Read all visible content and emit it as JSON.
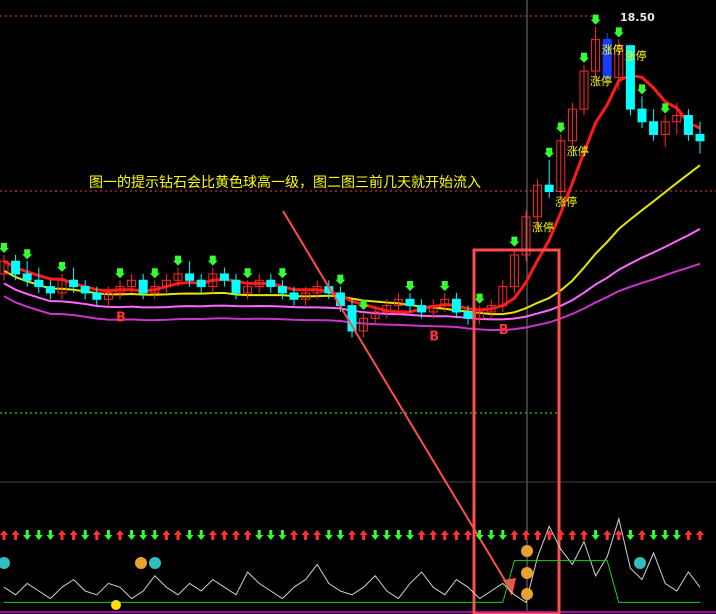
{
  "header": {
    "price_label": "18.50"
  },
  "annotation": {
    "text": "图一的提示钻石会比黄色球高一级，图二图三前几天就开始流入"
  },
  "labels": {
    "limit_up": "涨停",
    "buy": "B"
  },
  "colors": {
    "background": "#000000",
    "up_candle": "#ff2a2a",
    "down_candle": "#00ffff",
    "limit_candle": "#1a3cff",
    "ma_short": "#ff1a1a",
    "ma_mid": "#e6e600",
    "ma_long": "#ff66ff",
    "ma_slow": "#cc33cc",
    "highlight_box": "#ff4d4d",
    "arrow_down": "#33ff33",
    "arrow_up": "#ff3333",
    "limit_label": "#ffff00",
    "buy_label": "#ff3333",
    "grid_dashed": "#ff3333"
  },
  "chart_data": {
    "type": "candlestick",
    "candles": [
      [
        14.6,
        14.9,
        14.5,
        14.8
      ],
      [
        14.8,
        14.9,
        14.5,
        14.6
      ],
      [
        14.6,
        14.8,
        14.4,
        14.5
      ],
      [
        14.5,
        14.7,
        14.3,
        14.4
      ],
      [
        14.4,
        14.5,
        14.2,
        14.3
      ],
      [
        14.3,
        14.6,
        14.2,
        14.5
      ],
      [
        14.5,
        14.7,
        14.3,
        14.4
      ],
      [
        14.4,
        14.5,
        14.2,
        14.3
      ],
      [
        14.3,
        14.4,
        14.1,
        14.2
      ],
      [
        14.2,
        14.4,
        14.1,
        14.3
      ],
      [
        14.3,
        14.5,
        14.2,
        14.4
      ],
      [
        14.4,
        14.6,
        14.3,
        14.5
      ],
      [
        14.5,
        14.6,
        14.2,
        14.3
      ],
      [
        14.3,
        14.5,
        14.2,
        14.4
      ],
      [
        14.4,
        14.6,
        14.3,
        14.5
      ],
      [
        14.5,
        14.7,
        14.4,
        14.6
      ],
      [
        14.6,
        14.8,
        14.4,
        14.5
      ],
      [
        14.5,
        14.6,
        14.3,
        14.4
      ],
      [
        14.4,
        14.7,
        14.3,
        14.6
      ],
      [
        14.6,
        14.7,
        14.4,
        14.5
      ],
      [
        14.5,
        14.6,
        14.2,
        14.3
      ],
      [
        14.3,
        14.5,
        14.2,
        14.4
      ],
      [
        14.4,
        14.6,
        14.3,
        14.5
      ],
      [
        14.5,
        14.6,
        14.3,
        14.4
      ],
      [
        14.4,
        14.5,
        14.2,
        14.3
      ],
      [
        14.3,
        14.4,
        14.1,
        14.2
      ],
      [
        14.2,
        14.4,
        14.1,
        14.3
      ],
      [
        14.3,
        14.5,
        14.2,
        14.4
      ],
      [
        14.4,
        14.5,
        14.2,
        14.3
      ],
      [
        14.3,
        14.4,
        14.0,
        14.1
      ],
      [
        14.1,
        14.2,
        13.6,
        13.7
      ],
      [
        13.7,
        14.0,
        13.6,
        13.9
      ],
      [
        13.9,
        14.1,
        13.8,
        14.0
      ],
      [
        14.0,
        14.2,
        13.9,
        14.1
      ],
      [
        14.1,
        14.3,
        14.0,
        14.2
      ],
      [
        14.2,
        14.3,
        14.0,
        14.1
      ],
      [
        14.1,
        14.2,
        13.9,
        14.0
      ],
      [
        14.0,
        14.2,
        13.9,
        14.1
      ],
      [
        14.1,
        14.3,
        14.0,
        14.2
      ],
      [
        14.2,
        14.3,
        13.9,
        14.0
      ],
      [
        14.0,
        14.1,
        13.8,
        13.9
      ],
      [
        13.9,
        14.1,
        13.8,
        14.0
      ],
      [
        14.0,
        14.2,
        13.9,
        14.1
      ],
      [
        14.1,
        14.5,
        14.0,
        14.4
      ],
      [
        14.4,
        15.0,
        14.3,
        14.9
      ],
      [
        14.9,
        15.6,
        14.8,
        15.5
      ],
      [
        15.5,
        16.1,
        15.3,
        16.0
      ],
      [
        16.0,
        16.4,
        15.8,
        15.9
      ],
      [
        15.9,
        16.8,
        15.8,
        16.7
      ],
      [
        16.7,
        17.3,
        16.6,
        17.2
      ],
      [
        17.2,
        17.9,
        17.1,
        17.8
      ],
      [
        17.8,
        18.5,
        17.7,
        18.3
      ],
      [
        18.3,
        18.4,
        17.6,
        17.7
      ],
      [
        17.7,
        18.3,
        17.5,
        18.2
      ],
      [
        18.2,
        18.2,
        17.1,
        17.2
      ],
      [
        17.2,
        17.4,
        16.9,
        17.0
      ],
      [
        17.0,
        17.2,
        16.7,
        16.8
      ],
      [
        16.8,
        17.1,
        16.6,
        17.0
      ],
      [
        17.0,
        17.3,
        16.8,
        17.1
      ],
      [
        17.1,
        17.2,
        16.7,
        16.8
      ],
      [
        16.8,
        17.0,
        16.5,
        16.7
      ]
    ],
    "oscillator": [
      6,
      4,
      7,
      5,
      3,
      6,
      8,
      5,
      4,
      7,
      6,
      3,
      5,
      9,
      6,
      4,
      7,
      5,
      8,
      6,
      4,
      10,
      7,
      5,
      3,
      6,
      8,
      12,
      7,
      5,
      4,
      6,
      9,
      5,
      3,
      7,
      10,
      6,
      4,
      8,
      6,
      3,
      5,
      7,
      4,
      2,
      14,
      22,
      16,
      12,
      18,
      9,
      14,
      24,
      11,
      8,
      15,
      7,
      5,
      10,
      6
    ]
  }
}
